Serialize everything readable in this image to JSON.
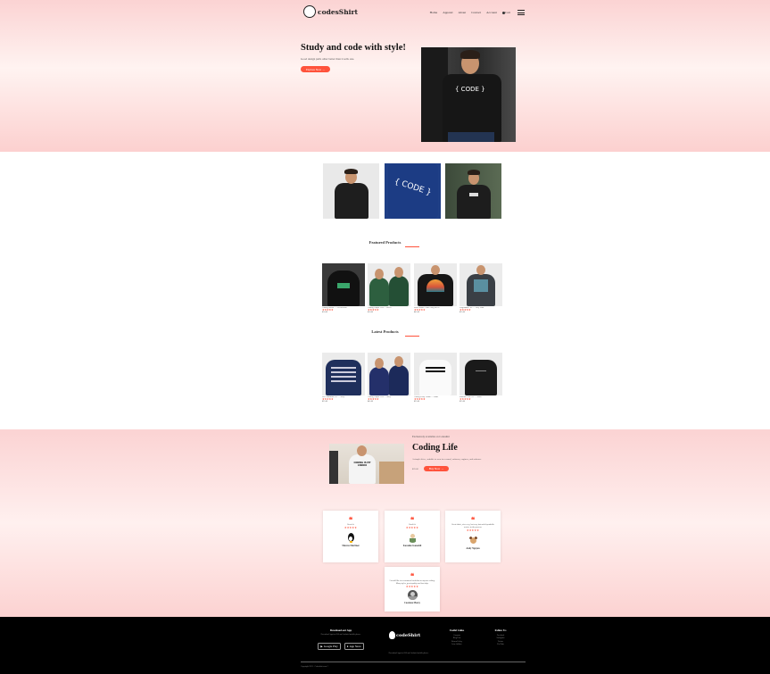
{
  "brand": {
    "logo_text": "codesShirt"
  },
  "nav": {
    "links": [
      "Home",
      "Apparel",
      "About",
      "Contact",
      "Account"
    ],
    "cart_label": "Cart"
  },
  "hero": {
    "title": "Study and code with style!",
    "subtitle": "Good design pulls other better than it sells one.",
    "button": "Explore Now →",
    "shirt_print": "{ CODE }"
  },
  "sections": {
    "featured_title": "Featured Products",
    "latest_title": "Latest Products"
  },
  "featured_products": [
    {
      "name": "Coding Hoodie — Green/Black",
      "stars": "★★★★★",
      "price": "$50.00"
    },
    {
      "name": "Coding Couple Tees — Green",
      "stars": "★★★★★",
      "price": "$50.00"
    },
    {
      "name": "Retro Sunset Coder Long Sleeve",
      "stars": "★★★★★",
      "price": "$45.00"
    },
    {
      "name": "Programmer Tee — Grey Print",
      "stars": "★★★★★",
      "price": "$35.00"
    }
  ],
  "latest_products": [
    {
      "name": "Git Commands Tee — Navy",
      "stars": "★★★★★",
      "price": "$25.00"
    },
    {
      "name": "Coding Couple Tees — Navy",
      "stars": "★★★★★",
      "price": "$45.00"
    },
    {
      "name": "Coding Is My Cardio — White",
      "stars": "★★★★★",
      "price": "$25.00"
    },
    {
      "name": "Minimal Code Tee — Black",
      "stars": "★★★★★",
      "price": "$25.00"
    }
  ],
  "offer": {
    "tag": "Exclusively available on Codeshirt",
    "title": "Coding Life",
    "description": "A simple fit tee, suitable to wear in a casual, softwear, engineer, and software.",
    "price_label": "$25.00",
    "button": "Buy Now →",
    "shirt_print": "CODING IS MY CARDIO"
  },
  "testimonials": [
    {
      "text": "Great fit.",
      "stars": "★★★★★",
      "name": "Marcus Martinez"
    },
    {
      "text": "Good fit.",
      "stars": "★★★★★",
      "name": "Kawaike Ganashil"
    },
    {
      "text": "Great fabric, nice very, but very fast and dependable service to the process.",
      "stars": "★★★★★",
      "name": "Andy Nguyen"
    },
    {
      "text": "I would like to recommend codeshirt to anyone coding. Many styles, great quality and fast ship.",
      "stars": "★★★★★",
      "name": "Cassiano Morey"
    }
  ],
  "footer": {
    "app_title": "Download our App",
    "app_sub": "Download App for iOS and Android mobile phone.",
    "google_play": "Google Play",
    "app_store": "App Store",
    "logo_text": "codeShirt",
    "mission": "Download App for iOS and Android mobile phone.",
    "useful_title": "Useful Links",
    "useful_links": [
      "Coupons",
      "Blog Post",
      "Return Policy",
      "Join Affiliate"
    ],
    "follow_title": "Follow Us",
    "follow_links": [
      "Facebook",
      "Instagram",
      "Twitter",
      "YouTube"
    ],
    "copyright": "Copyright 2021 · Codeshirt team ©"
  },
  "colors": {
    "accent": "#ff523b",
    "hero_bg": "#fbd3d3",
    "footer_bg": "#000000"
  }
}
